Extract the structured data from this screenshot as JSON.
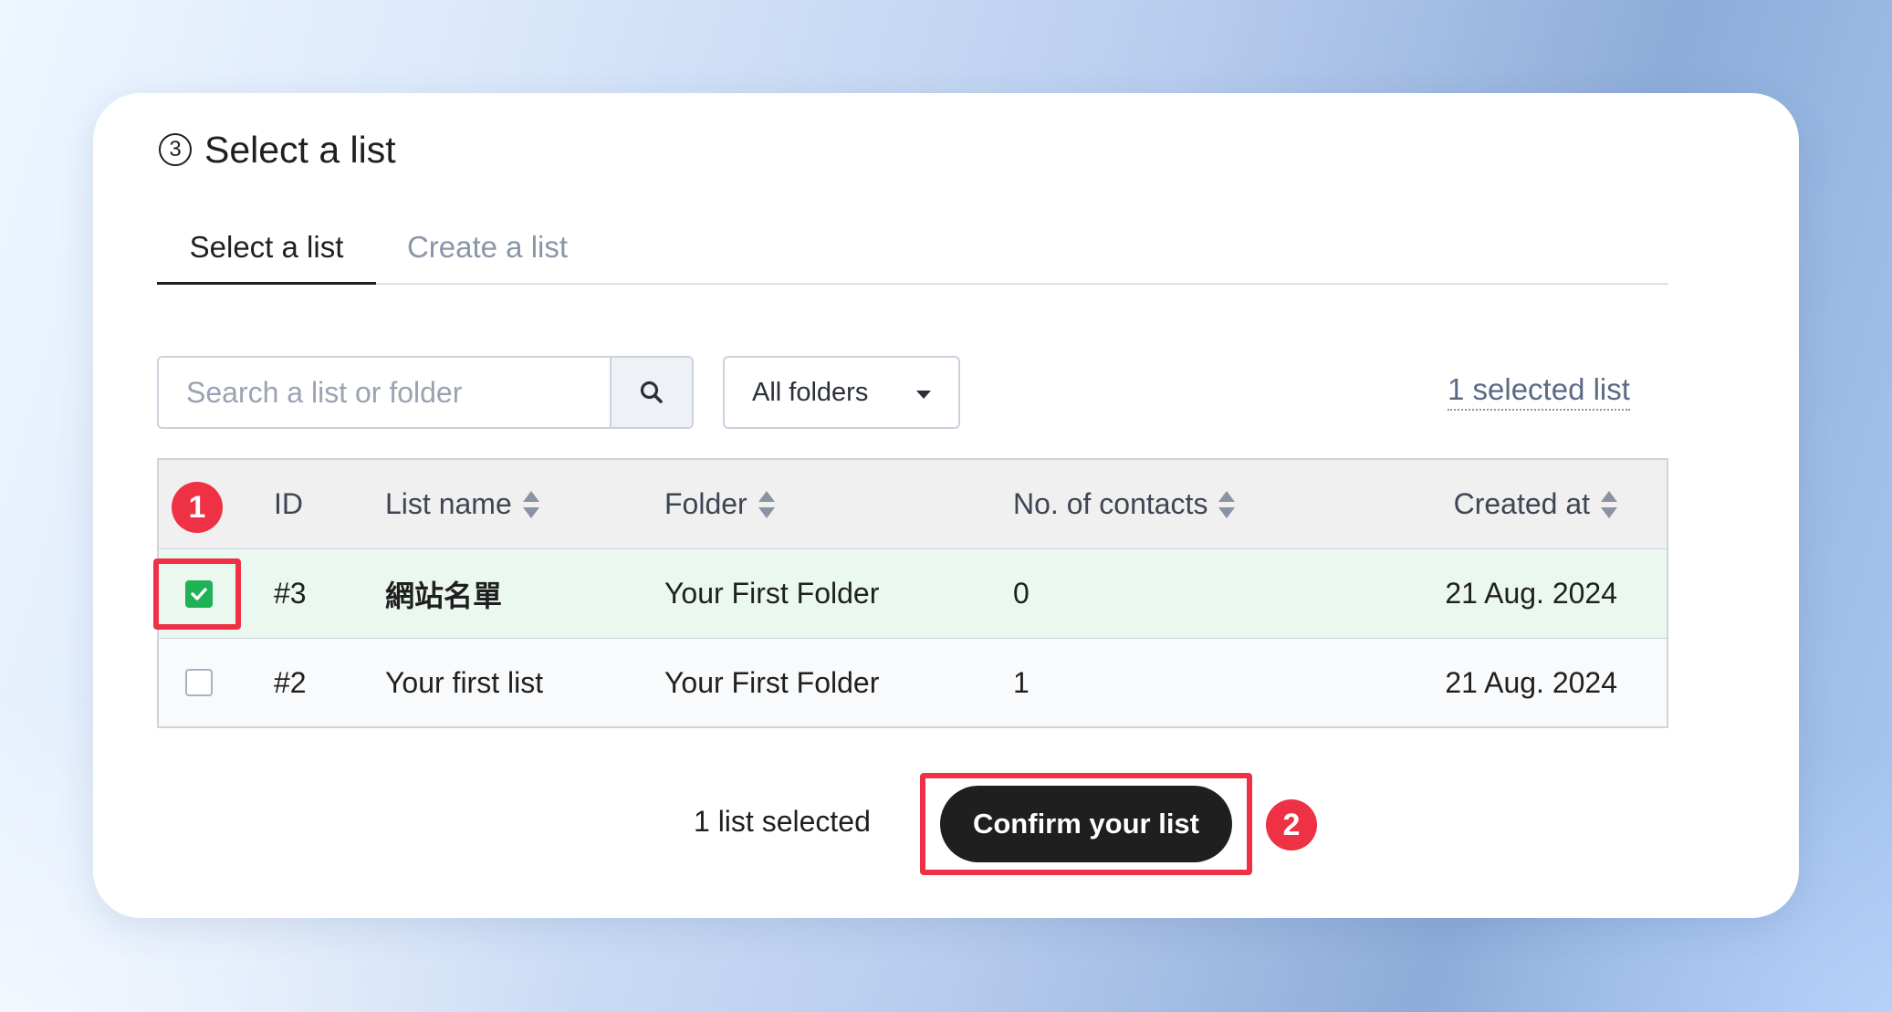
{
  "step": {
    "number": "3",
    "title": "Select a list"
  },
  "tabs": [
    {
      "label": "Select a list",
      "active": true
    },
    {
      "label": "Create a list",
      "active": false
    }
  ],
  "search": {
    "placeholder": "Search a list or folder",
    "value": ""
  },
  "folder_filter": {
    "selected": "All folders"
  },
  "selected_link": "1 selected list",
  "table": {
    "columns": [
      "ID",
      "List name",
      "Folder",
      "No. of contacts",
      "Created at"
    ],
    "rows": [
      {
        "checked": true,
        "id": "#3",
        "name": "網站名單",
        "folder": "Your First Folder",
        "contacts": "0",
        "created": "21 Aug. 2024"
      },
      {
        "checked": false,
        "id": "#2",
        "name": "Your first list",
        "folder": "Your First Folder",
        "contacts": "1",
        "created": "21 Aug. 2024"
      }
    ]
  },
  "footer": {
    "selected_count": "1 list selected",
    "confirm_label": "Confirm your list"
  },
  "annotations": {
    "badge_1": "1",
    "badge_2": "2",
    "color": "#ee3145"
  },
  "colors": {
    "checkbox_checked": "#1fb156",
    "selected_row": "#ebf8ef",
    "primary_button": "#1f1f1f"
  }
}
